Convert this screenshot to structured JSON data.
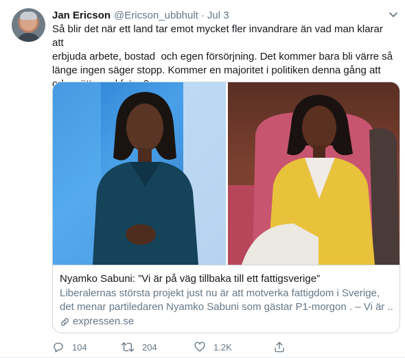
{
  "tweet": {
    "author_name": "Jan Ericson",
    "author_handle": "@Ericson_ubbhult",
    "separator": "·",
    "date": "Jul 3",
    "text": "Så blir det när ett land tar emot mycket fler invandrare än vad man klarar att\nerbjuda arbete, bostad  och egen försörjning. Det kommer bara bli värre så\nlänge ingen säger stopp. Kommer en majoritet i politiken denna gång att\norka sätta ned foten?",
    "card": {
      "title": "Nyamko Sabuni: ”Vi är på väg tillbaka till ett fattigsverige”",
      "description_lines": [
        "Liberalernas största projekt just nu är att motverka fattigdom i Sverige,",
        "det menar partiledaren Nyamko Sabuni som gästar P1-morgon . – Vi är ..."
      ],
      "domain": "expressen.se"
    },
    "actions": {
      "replies": "104",
      "retweets": "204",
      "likes": "1.2K"
    }
  },
  "colors": {
    "text": "#14171a",
    "secondary": "#657786",
    "border": "#ccd6dd"
  },
  "icons": [
    "chevron-down-icon",
    "link-icon",
    "reply-icon",
    "retweet-icon",
    "like-icon",
    "share-icon"
  ]
}
